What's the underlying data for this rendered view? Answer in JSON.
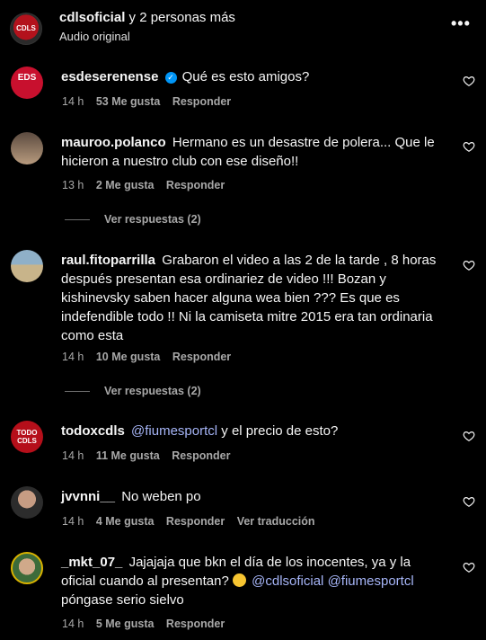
{
  "header": {
    "user": "cdlsoficial",
    "rest": "y 2 personas más",
    "subtitle": "Audio original",
    "avatar_text": "CDLS",
    "more": "•••"
  },
  "labels": {
    "reply": "Responder",
    "view_replies": "Ver respuestas (2)",
    "see_translation": "Ver traducción"
  },
  "comments": [
    {
      "user": "esdeserenense",
      "verified": true,
      "text": "Qué es esto amigos?",
      "time": "14 h",
      "likes": "53 Me gusta",
      "avatar_text": "EDS"
    },
    {
      "user": "mauroo.polanco",
      "text": "Hermano es un desastre de polera... Que le hicieron a nuestro club con ese diseño!!",
      "time": "13 h",
      "likes": "2 Me gusta",
      "replies": "Ver respuestas (2)"
    },
    {
      "user": "raul.fitoparrilla",
      "text": "Grabaron el video a las 2 de la tarde , 8 horas después presentan esa ordinariez de video !!! Bozan y kishinevsky saben hacer alguna wea bien ??? Es que es indefendible todo !! Ni la camiseta mitre 2015 era tan ordinaria como esta",
      "time": "14 h",
      "likes": "10 Me gusta",
      "replies": "Ver respuestas (2)"
    },
    {
      "user": "todoxcdls",
      "mention": "@fiumesportcl",
      "text": " y el precio de esto?",
      "time": "14 h",
      "likes": "11 Me gusta",
      "avatar_text": "TODO CDLS"
    },
    {
      "user": "jvvnni__",
      "text": "No weben po",
      "time": "14 h",
      "likes": "4 Me gusta"
    },
    {
      "user": "_mkt_07_",
      "text_a": "Jajajaja que bkn el día de los inocentes, ya y la oficial cuando al presentan?",
      "mention_a": "@cdlsoficial",
      "mention_b": "@fiumesportcl",
      "text_b": " póngase serio sielvo",
      "time": "14 h",
      "likes": "5 Me gusta"
    }
  ]
}
